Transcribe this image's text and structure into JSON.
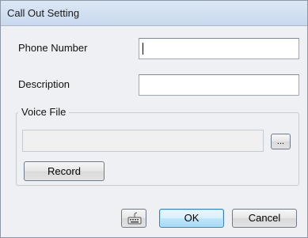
{
  "window": {
    "title": "Call Out Setting"
  },
  "form": {
    "phone_label": "Phone Number",
    "phone_value": "",
    "description_label": "Description",
    "description_value": ""
  },
  "voice_group": {
    "title": "Voice File",
    "file_value": "",
    "browse_label": "...",
    "record_label": "Record"
  },
  "footer": {
    "keyboard_icon": "keyboard-icon",
    "ok_label": "OK",
    "cancel_label": "Cancel"
  },
  "colors": {
    "title_bar": "#c9d9ee",
    "dialog_background": "#eef0f4",
    "default_button_border": "#3c7fb1"
  }
}
